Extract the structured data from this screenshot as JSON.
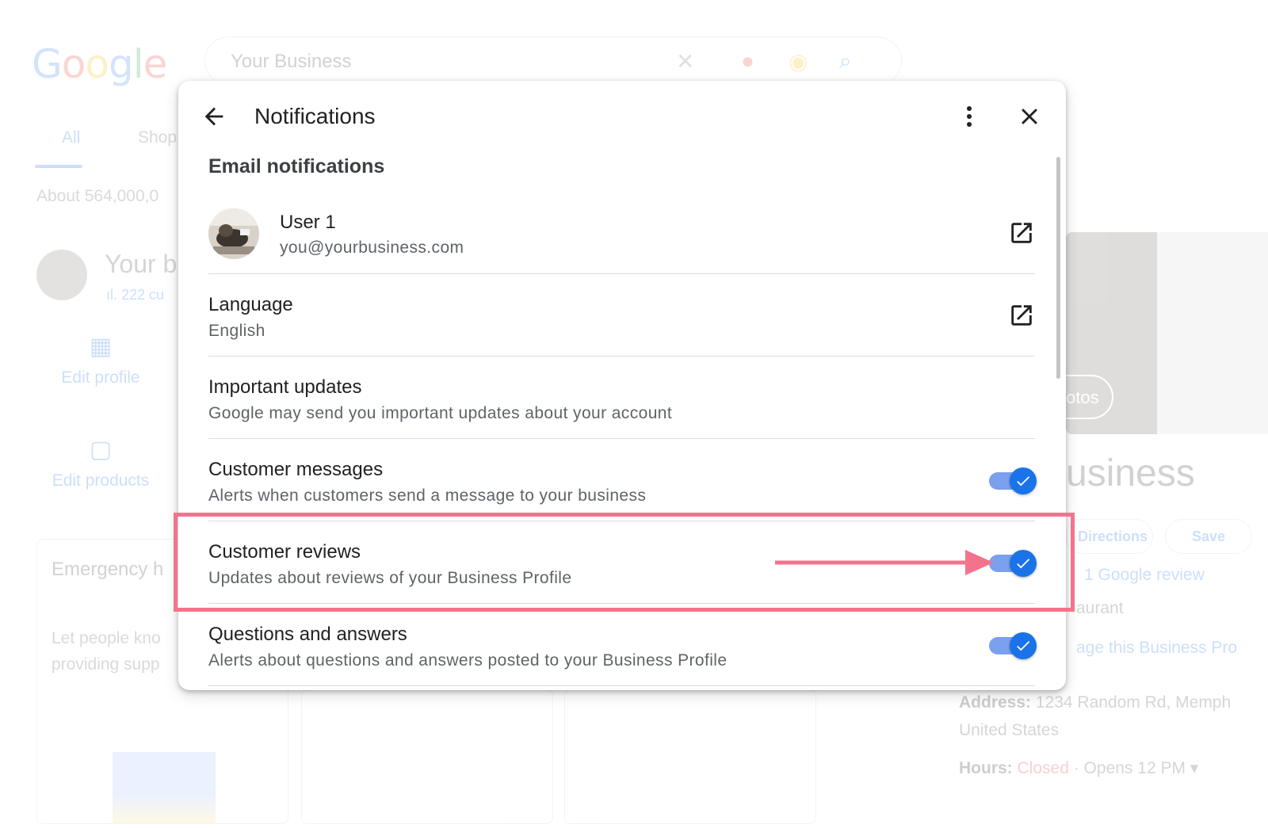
{
  "background": {
    "logo": [
      "G",
      "o",
      "o",
      "g",
      "l",
      "e"
    ],
    "search_value": "Your Business",
    "tab_all": "All",
    "tab_shopping": "Shop",
    "results_count": "About 564,000,0",
    "business_name": "Your b",
    "business_stat": "222 cu",
    "action_edit_profile": "Edit profile",
    "action_edit_products": "Edit products",
    "card_title": "Emergency h",
    "card_desc_1": "Let people kno",
    "card_desc_2": "providing supp",
    "photos_label": "otos",
    "right_name": "usiness",
    "btn_directions": "Directions",
    "btn_save": "Save",
    "review_link": "1 Google review",
    "category": "aurant",
    "manage": "age this Business Pro",
    "address_label": "Address:",
    "address_value": " 1234 Random Rd, Memph",
    "address_country": "United States",
    "hours_label": "Hours:",
    "hours_status": "Closed",
    "hours_opens": " · Opens 12 PM ▾"
  },
  "dialog": {
    "title": "Notifications",
    "section_title": "Email notifications",
    "user": {
      "name": "User 1",
      "email": "you@yourbusiness.com"
    },
    "language": {
      "title": "Language",
      "value": "English"
    },
    "important_updates": {
      "title": "Important updates",
      "description": "Google may send you important updates about your account"
    },
    "customer_messages": {
      "title": "Customer messages",
      "description": "Alerts when customers send a message to your business",
      "enabled": true
    },
    "customer_reviews": {
      "title": "Customer reviews",
      "description": "Updates about reviews of your Business Profile",
      "enabled": true
    },
    "questions_answers": {
      "title": "Questions and answers",
      "description": "Alerts about questions and answers posted to your Business Profile",
      "enabled": true
    }
  },
  "colors": {
    "accent": "#1a73e8",
    "toggle_track": "#7aa0ee",
    "annotation": "#f4738c",
    "divider": "#dadce0"
  },
  "icons": [
    "back-arrow-icon",
    "more-vert-icon",
    "close-icon",
    "open-in-new-icon",
    "check-icon"
  ]
}
